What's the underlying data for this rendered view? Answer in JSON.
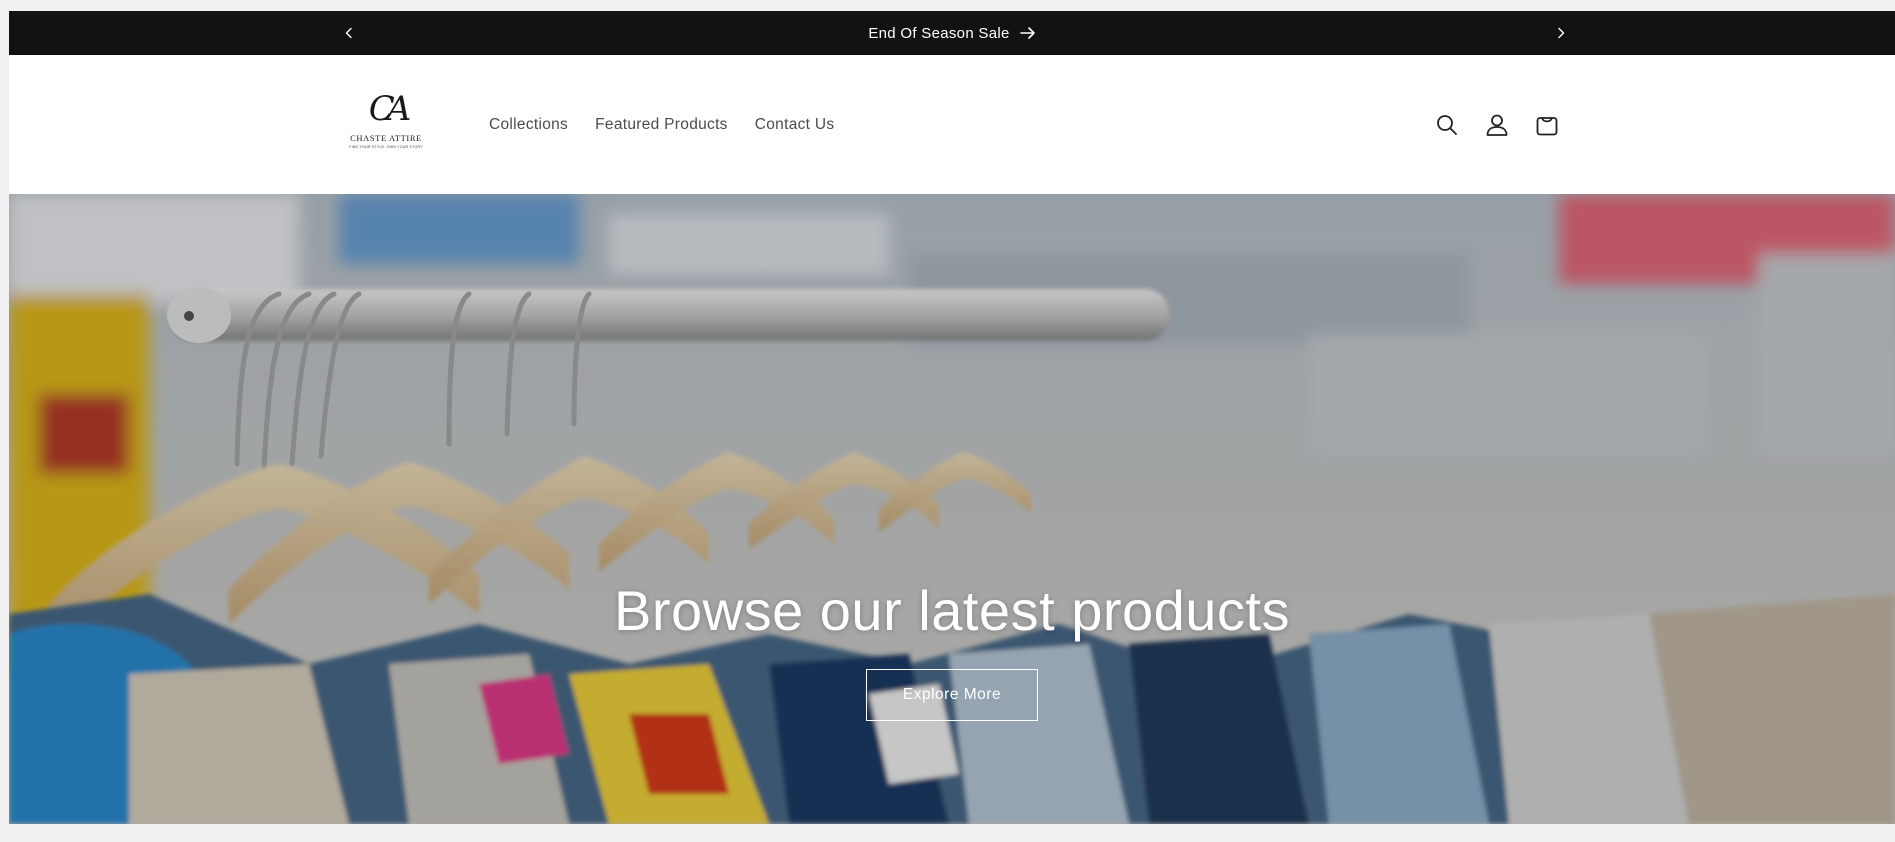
{
  "announcement": {
    "text": "End Of Season Sale"
  },
  "brand": {
    "mark": "CA",
    "name": "CHASTE ATTIRE",
    "tagline": "FIND YOUR STYLE. OWN YOUR STORY"
  },
  "nav": {
    "items": [
      {
        "label": "Collections"
      },
      {
        "label": "Featured Products"
      },
      {
        "label": "Contact Us"
      }
    ]
  },
  "hero": {
    "title": "Browse our latest products",
    "button_label": "Explore More"
  },
  "colors": {
    "announcement_bg": "#121212",
    "nav_text": "#4b4b4b",
    "hero_text": "#ffffff"
  }
}
